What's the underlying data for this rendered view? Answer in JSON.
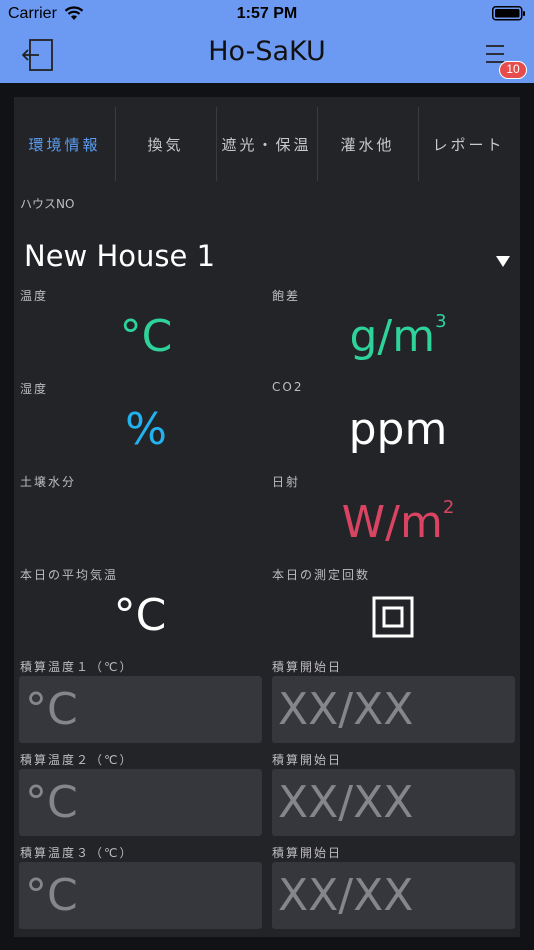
{
  "status": {
    "carrier": "Carrier",
    "time": "1:57 PM"
  },
  "nav": {
    "title": "Ho-SaKU",
    "badge_count": "10"
  },
  "tabs": [
    {
      "label": "環境情報",
      "active": true
    },
    {
      "label": "換気",
      "active": false
    },
    {
      "label": "遮光・保温",
      "active": false
    },
    {
      "label": "灌水他",
      "active": false
    },
    {
      "label": "レポート",
      "active": false
    }
  ],
  "house": {
    "label": "ハウスNO",
    "value": "New House 1"
  },
  "readings": {
    "temperature": {
      "label": "温度",
      "unit": "°C",
      "color": "#2ed39a"
    },
    "saturation_deficit": {
      "label": "飽差",
      "unit": "g/m",
      "sup": "3",
      "color": "#2ed39a"
    },
    "humidity": {
      "label": "湿度",
      "unit": "%",
      "color": "#22b2f0"
    },
    "co2": {
      "label": "CO2",
      "unit": "ppm",
      "color": "#ffffff"
    },
    "soil_moisture": {
      "label": "土壌水分",
      "unit": ""
    },
    "solar": {
      "label": "日射",
      "unit": "W/m",
      "sup": "2",
      "color": "#d94462"
    },
    "avg_temp_today": {
      "label": "本日の平均気温",
      "unit": "°C",
      "color": "#ffffff"
    },
    "measure_count_today": {
      "label": "本日の測定回数",
      "icon": "square-frame-icon"
    }
  },
  "accumulated": [
    {
      "label": "積算温度１（℃）",
      "value": "°C",
      "start_label": "積算開始日",
      "start_value": "XX/XX"
    },
    {
      "label": "積算温度２（℃）",
      "value": "°C",
      "start_label": "積算開始日",
      "start_value": "XX/XX"
    },
    {
      "label": "積算温度３（℃）",
      "value": "°C",
      "start_label": "積算開始日",
      "start_value": "XX/XX"
    }
  ],
  "colors": {
    "nav_bg": "#6c99f2",
    "panel_bg": "#232428",
    "page_bg": "#111215",
    "active_tab": "#5b9bf0",
    "badge": "#e74c4c"
  }
}
